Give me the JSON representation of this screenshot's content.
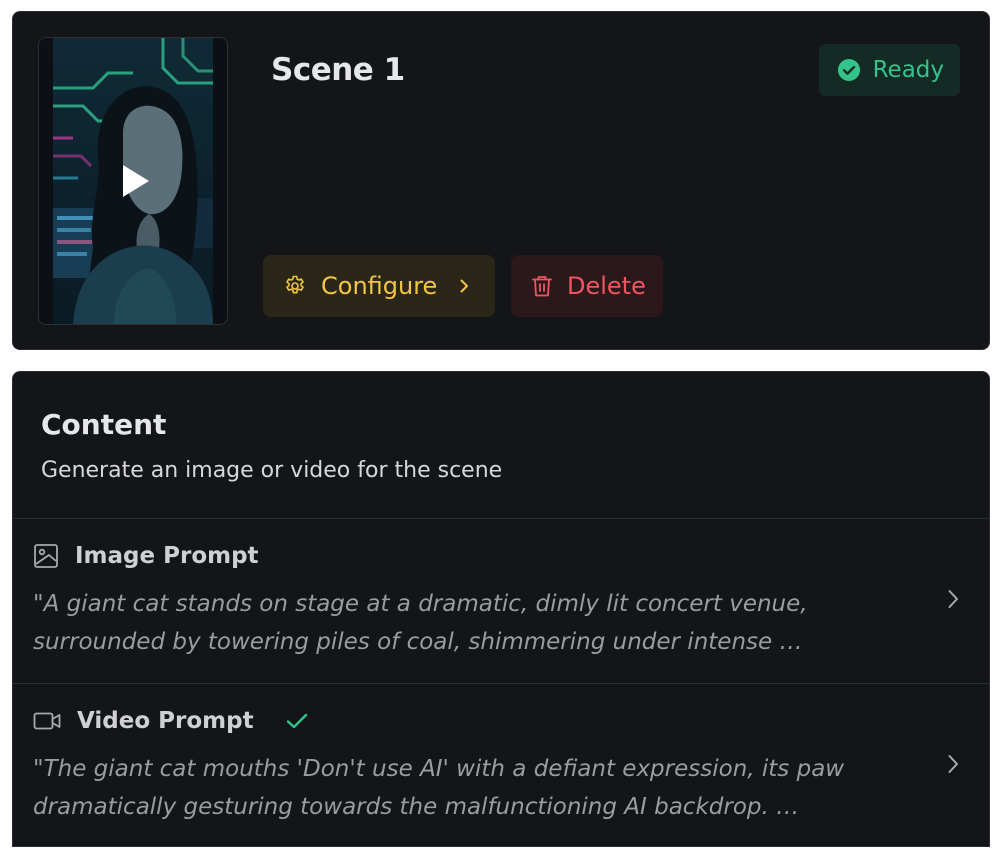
{
  "scene": {
    "title": "Scene 1",
    "status": "Ready",
    "configure_label": "Configure",
    "delete_label": "Delete"
  },
  "content": {
    "title": "Content",
    "subtitle": "Generate an image or video for the scene",
    "image_prompt": {
      "label": "Image Prompt",
      "text": "\"A giant cat stands on stage at a dramatic, dimly lit concert venue, surrounded by towering piles of coal, shimmering under intense …"
    },
    "video_prompt": {
      "label": "Video Prompt",
      "completed": true,
      "text": "\"The giant cat mouths 'Don't use AI' with a defiant expression, its paw dramatically gesturing towards the malfunctioning AI backdrop. …"
    }
  },
  "colors": {
    "ready": "#34c48b",
    "configure": "#f2c542",
    "delete": "#f0555f",
    "card_bg": "#131519"
  },
  "icons": [
    "play-icon",
    "check-circle-icon",
    "gear-icon",
    "chevron-right-icon",
    "trash-icon",
    "image-icon",
    "video-camera-icon",
    "checkmark-icon"
  ]
}
